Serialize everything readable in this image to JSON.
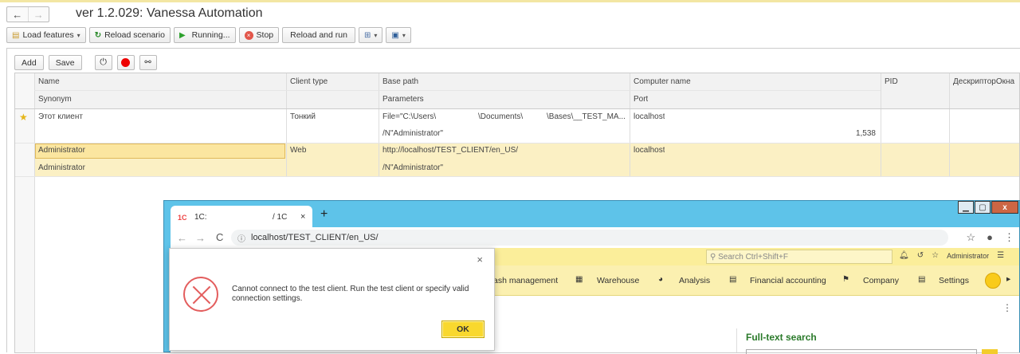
{
  "app": {
    "title": "ver 1.2.029: Vanessa Automation",
    "back": "←",
    "forward": "→"
  },
  "toolbar": {
    "load_features": "Load features",
    "reload_scenario": "Reload scenario",
    "running": "Running...",
    "stop": "Stop",
    "reload_and_run": "Reload and run"
  },
  "panel": {
    "add": "Add",
    "save": "Save"
  },
  "grid": {
    "headers": {
      "name": "Name",
      "synonym": "Synonym",
      "client_type": "Client type",
      "base_path": "Base path",
      "parameters": "Parameters",
      "computer_name": "Computer name",
      "port": "Port",
      "pid": "PID",
      "descriptor": "ДескрипторОкна"
    },
    "rows": [
      {
        "name": "Этот клиент",
        "synonym": "",
        "client_type": "Тонкий",
        "base_path": "File=\"C:\\Users\\",
        "base_path_2": "\\Documents\\",
        "base_path_3": "\\Bases\\__TEST_MA...",
        "parameters": "/N\"Administrator\"",
        "computer_name": "localhost",
        "port": "1,538"
      },
      {
        "name": "Administrator",
        "synonym": "Administrator",
        "client_type": "Web",
        "base_path": "http://localhost/TEST_CLIENT/en_US/",
        "parameters": "/N\"Administrator\"",
        "computer_name": "localhost",
        "port": ""
      }
    ]
  },
  "browser": {
    "tab_title_a": "1C:",
    "tab_title_b": "/ 1C",
    "tab_close": "×",
    "new_tab": "+",
    "url": "localhost/TEST_CLIENT/en_US/",
    "search_placeholder": "Search Ctrl+Shift+F",
    "user": "Administrator",
    "menu": {
      "cash": "ash management",
      "warehouse": "Warehouse",
      "analysis": "Analysis",
      "financial": "Financial accounting",
      "company": "Company",
      "settings": "Settings"
    },
    "full_text_search": "Full-text search"
  },
  "dialog": {
    "message": "Cannot connect to the test client. Run the test client or specify valid connection settings.",
    "ok": "OK",
    "close": "×"
  }
}
